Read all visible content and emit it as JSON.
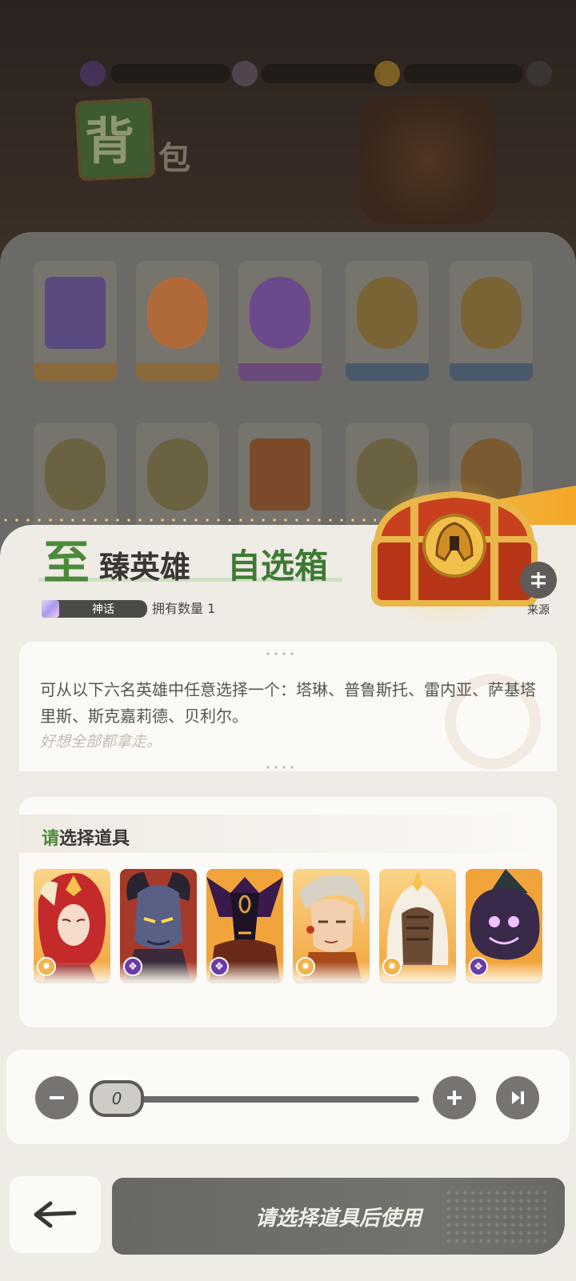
{
  "background": {
    "title_main": "背",
    "title_sub": "包"
  },
  "item": {
    "title_first": "至",
    "title_mid": "臻英雄",
    "title_green": "自选箱",
    "rarity": "神话",
    "owned_label": "拥有数量 1",
    "source_label": "来源",
    "description": "可从以下六名英雄中任意选择一个：塔琳、普鲁斯托、雷内亚、萨基塔里斯、斯克嘉莉德、贝利尔。",
    "flavor": "好想全部都拿走。"
  },
  "select": {
    "title_highlight": "请",
    "title_rest": "选择道具",
    "heroes": [
      {
        "faction": "star-faction-icon",
        "color": "#f4b24a"
      },
      {
        "faction": "void-faction-icon",
        "color": "#6b3ca8"
      },
      {
        "faction": "void-faction-icon",
        "color": "#6b3ca8"
      },
      {
        "faction": "star-faction-icon",
        "color": "#f4b24a"
      },
      {
        "faction": "star-faction-icon",
        "color": "#f4b24a"
      },
      {
        "faction": "void-faction-icon",
        "color": "#6b3ca8"
      }
    ]
  },
  "quantity": {
    "value": "0"
  },
  "footer": {
    "use_label": "请选择道具后使用"
  },
  "colors": {
    "accent_green": "#4a8a3a",
    "sheet": "#efebe5",
    "button_gray": "#777370",
    "gold": "#f4a424"
  }
}
